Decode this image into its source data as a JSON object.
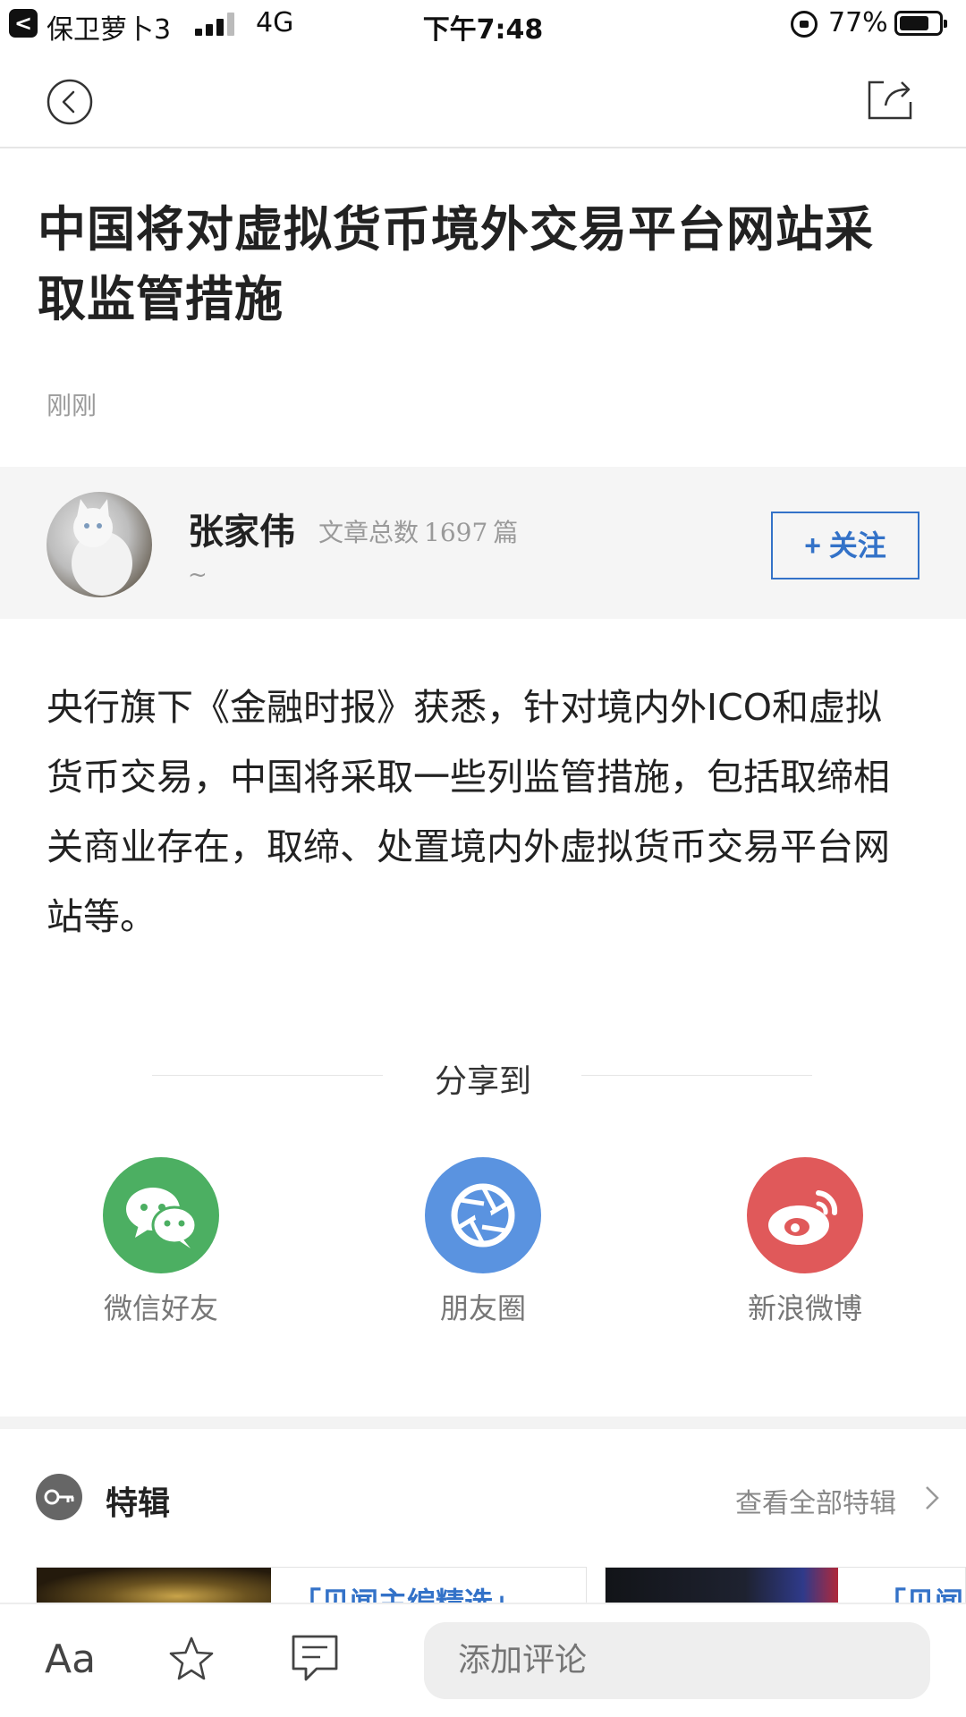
{
  "status_bar": {
    "back_glyph": "<",
    "carrier": "保卫萝卜3",
    "network": "4G",
    "time": "下午7:48",
    "battery_pct": "77%",
    "battery_level": 0.77
  },
  "nav": {
    "back_icon": "back-circle-icon",
    "share_icon": "share-export-icon"
  },
  "article": {
    "title": "中国将对虚拟货币境外交易平台网站采取监管措施",
    "time": "刚刚",
    "body": "央行旗下《金融时报》获悉，针对境内外ICO和虚拟货币交易，中国将采取一些列监管措施，包括取缔相关商业存在，取缔、处置境内外虚拟货币交易平台网站等。"
  },
  "author": {
    "name": "张家伟",
    "count_label": "文章总数",
    "count": "1697",
    "count_unit": "篇",
    "bio": "~",
    "follow_label": "+ 关注",
    "accent": "#3372c8"
  },
  "share": {
    "title": "分享到",
    "items": [
      {
        "label": "微信好友",
        "icon": "wechat-icon",
        "color": "#4caf62"
      },
      {
        "label": "朋友圈",
        "icon": "moments-icon",
        "color": "#5a93e0"
      },
      {
        "label": "新浪微博",
        "icon": "weibo-icon",
        "color": "#e0595a"
      }
    ]
  },
  "special": {
    "title": "特辑",
    "more": "查看全部特辑",
    "cards": [
      {
        "title": "「贝闻主编精选」"
      },
      {
        "title": "「贝闻"
      }
    ]
  },
  "bottom_bar": {
    "font_label": "Aa",
    "comment_placeholder": "添加评论"
  }
}
